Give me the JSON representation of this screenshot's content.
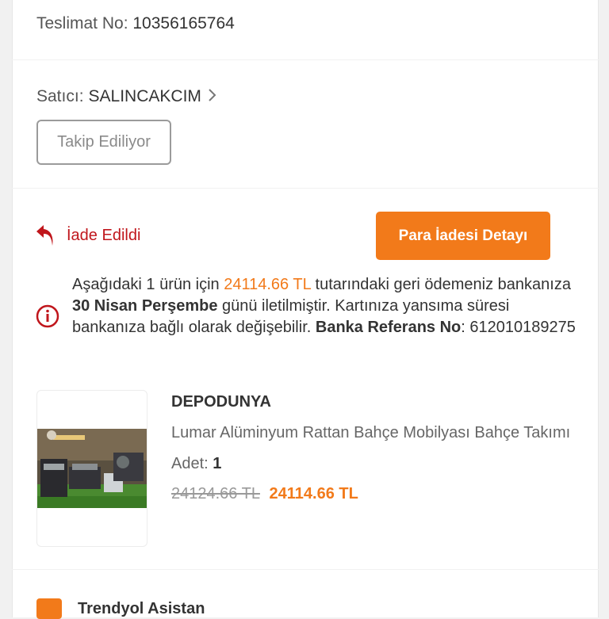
{
  "delivery": {
    "label": "Teslimat No:",
    "number": "10356165764"
  },
  "seller": {
    "label": "Satıcı:",
    "name": "SALINCAKCIM",
    "follow_button": "Takip Ediliyor"
  },
  "refund": {
    "status": "İade Edildi",
    "detail_button": "Para İadesi Detayı",
    "info": {
      "part1": "Aşağıdaki 1 ürün için ",
      "amount": "24114.66 TL",
      "part2": " tutarındaki geri ödemeniz bankanıza ",
      "date": "30 Nisan Perşembe",
      "part3": " günü iletilmiştir. Kartınıza yansıma süresi bankanıza bağlı olarak değişebilir. ",
      "ref_label": "Banka Referans No",
      "ref_sep": ": ",
      "ref_number": "612010189275"
    }
  },
  "product": {
    "brand": "DEPODUNYA",
    "name": "Lumar Alüminyum Rattan Bahçe Mobilyası Bahçe Takımı",
    "qty_label": "Adet: ",
    "qty_value": "1",
    "old_price": "24124.66 TL",
    "new_price": "24114.66 TL"
  },
  "assistant": {
    "title": "Trendyol Asistan"
  },
  "colors": {
    "accent": "#f27a1a",
    "status_red": "#c0161c"
  }
}
